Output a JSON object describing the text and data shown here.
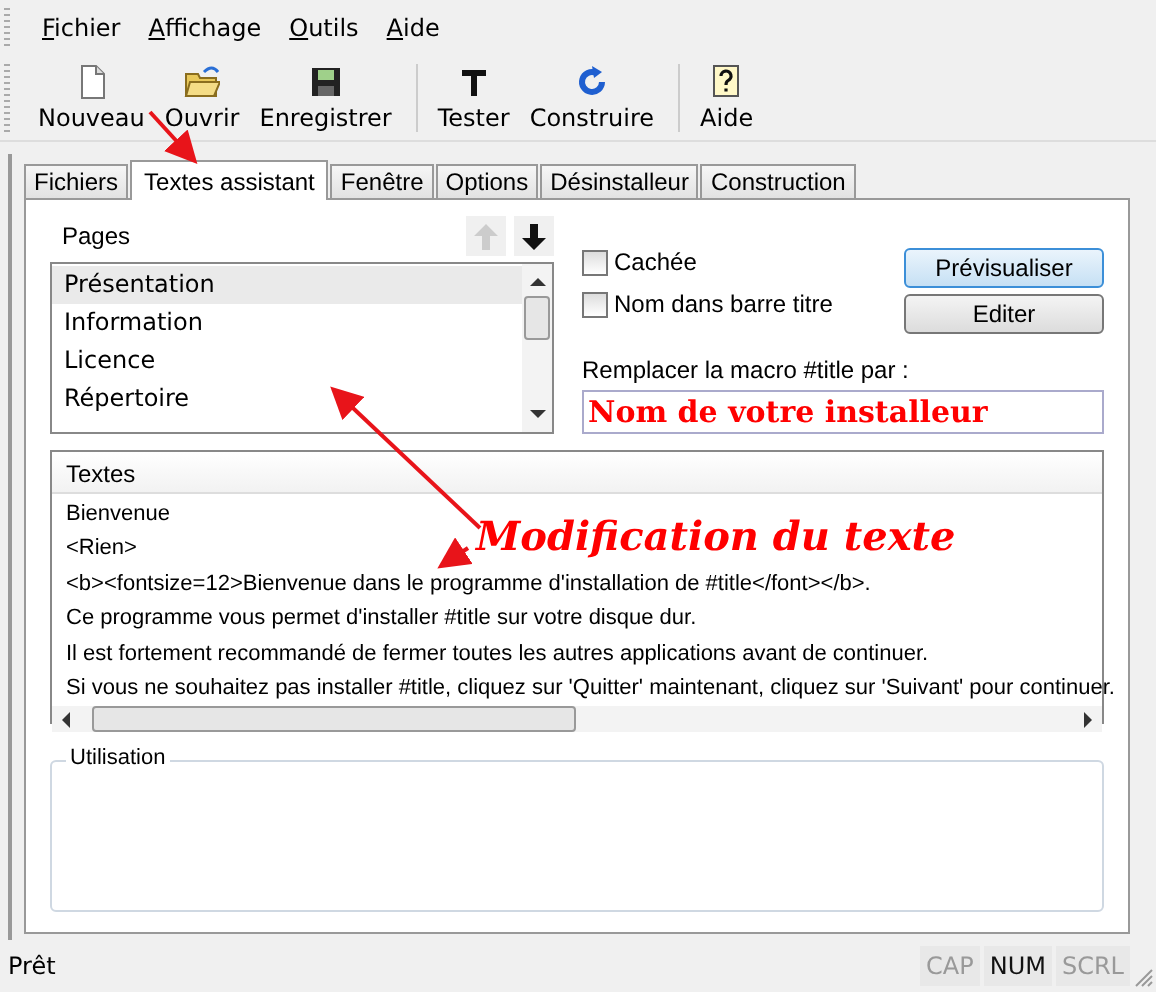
{
  "menu": [
    {
      "label": "Fichier"
    },
    {
      "label": "Affichage"
    },
    {
      "label": "Outils"
    },
    {
      "label": "Aide"
    }
  ],
  "toolbar": [
    {
      "kind": "new",
      "label": "Nouveau"
    },
    {
      "kind": "open",
      "label": "Ouvrir"
    },
    {
      "kind": "save",
      "label": "Enregistrer"
    },
    {
      "kind": "sep"
    },
    {
      "kind": "test",
      "label": "Tester"
    },
    {
      "kind": "build",
      "label": "Construire"
    },
    {
      "kind": "sep"
    },
    {
      "kind": "help",
      "label": "Aide"
    }
  ],
  "tabs": [
    {
      "label": "Fichiers",
      "selected": false
    },
    {
      "label": "Textes assistant",
      "selected": true
    },
    {
      "label": "Fenêtre",
      "selected": false
    },
    {
      "label": "Options",
      "selected": false
    },
    {
      "label": "Désinstalleur",
      "selected": false
    },
    {
      "label": "Construction",
      "selected": false
    }
  ],
  "pages": {
    "label": "Pages",
    "up_disabled": true,
    "down_disabled": false,
    "items": [
      {
        "label": "Présentation",
        "selected": true
      },
      {
        "label": "Information",
        "selected": false
      },
      {
        "label": "Licence",
        "selected": false
      },
      {
        "label": "Répertoire",
        "selected": false
      }
    ]
  },
  "checkboxes": [
    {
      "label": "Cachée",
      "checked": false
    },
    {
      "label": "Nom dans barre titre",
      "checked": false
    }
  ],
  "buttons": [
    {
      "label": "Prévisualiser",
      "default": true
    },
    {
      "label": "Editer",
      "default": false
    }
  ],
  "macro": {
    "label": "Remplacer la macro #title par :",
    "value": "Nom de votre installeur"
  },
  "texts": {
    "header": "Textes",
    "lines": [
      "Bienvenue",
      "<Rien>",
      "<b><fontsize=12>Bienvenue dans le programme d'installation de #title</font></b>.",
      "Ce programme vous permet d'installer #title sur votre disque dur.",
      "Il est fortement recommandé de fermer toutes les autres applications avant de continuer.",
      "Si vous ne souhaitez pas installer #title, cliquez sur 'Quitter' maintenant, cliquez sur 'Suivant' pour continuer."
    ]
  },
  "usage": {
    "label": "Utilisation"
  },
  "annotation": {
    "text": "Modification du texte"
  },
  "status_bar": {
    "text": "Prêt",
    "indicators": [
      {
        "label": "CAP",
        "on": false
      },
      {
        "label": "NUM",
        "on": true
      },
      {
        "label": "SCRL",
        "on": false
      }
    ]
  }
}
